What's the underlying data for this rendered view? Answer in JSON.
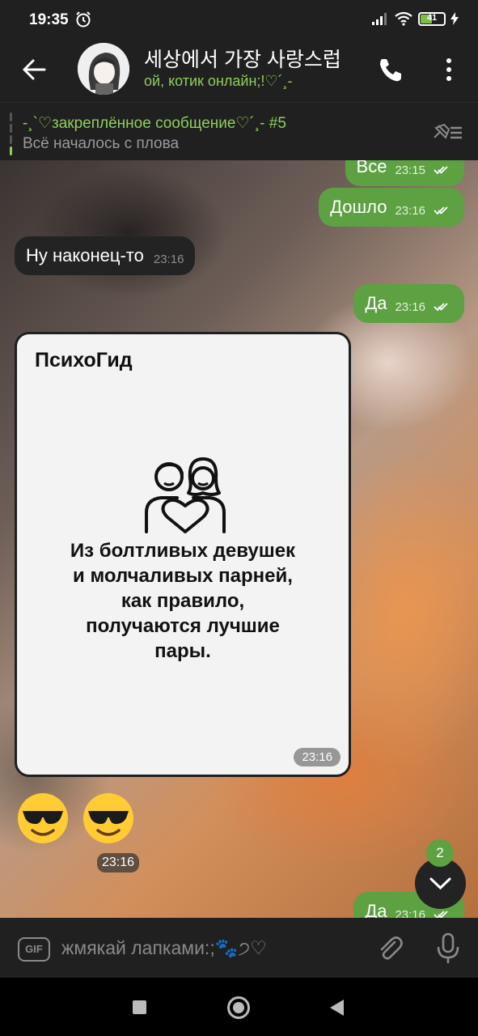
{
  "status_bar": {
    "time": "19:35",
    "battery_level": "41",
    "battery_color": "#7cc043"
  },
  "chat_header": {
    "title": "세상에서 가장 사랑스럽",
    "status": "ой, котик онлайн;!♡´¸-",
    "accent_color": "#8fce5a"
  },
  "pinned": {
    "title": "-¸`♡закреплённое сообщение♡´¸- #5",
    "text": "Всё началось с плова"
  },
  "messages": [
    {
      "direction": "out",
      "text": "Все",
      "time": "23:15",
      "read": true
    },
    {
      "direction": "out",
      "text": "Дошло",
      "time": "23:16",
      "read": true
    },
    {
      "direction": "in",
      "text": "Ну наконец-то",
      "time": "23:16"
    },
    {
      "direction": "out",
      "text": "Да",
      "time": "23:16",
      "read": true
    },
    {
      "direction": "in",
      "type": "image",
      "brand": "ПсихоГид",
      "quote_lines": [
        "Из болтливых девушек",
        "и молчаливых парней,",
        "как правило,",
        "получаются лучшие",
        "пары."
      ],
      "icon": "couple-heart-icon",
      "time": "23:16"
    },
    {
      "direction": "in",
      "type": "emoji",
      "emoji": [
        "smiling-face-with-sunglasses",
        "smiling-face-with-sunglasses"
      ],
      "time": "23:16"
    },
    {
      "direction": "out",
      "text": "Да",
      "time": "23:16",
      "read": true
    }
  ],
  "scroll_down": {
    "unread_count": "2"
  },
  "input": {
    "placeholder": "жмякай лапками:;🐾੭♡"
  },
  "colors": {
    "outgoing_bubble": "#5da143",
    "incoming_bubble": "#232323",
    "bar_background": "#202020"
  }
}
